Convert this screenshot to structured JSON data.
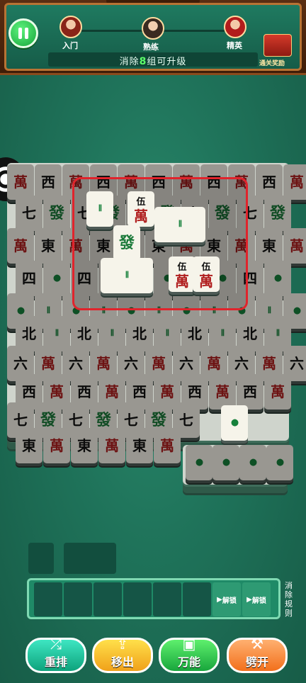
{
  "header": {
    "levels": [
      "入门",
      "熟练",
      "精英"
    ],
    "goal_prefix": "消除",
    "goal_count": "8",
    "goal_suffix": "组可升级",
    "reward_label": "通关奖励"
  },
  "tiles": {
    "wan_small": "伍",
    "wan_big": "萬",
    "six": "六",
    "bamboo": "𝍪",
    "green": "發",
    "dong": "東",
    "north": "北",
    "west": "西",
    "seven": "七",
    "four": "四",
    "bean": "●"
  },
  "tray": {
    "unlock_label": "解锁",
    "rules_label": "消除规则"
  },
  "tools": [
    {
      "label": "重排",
      "icon": "shuffle-icon"
    },
    {
      "label": "移出",
      "icon": "move-out-icon"
    },
    {
      "label": "万能",
      "icon": "wildcard-icon"
    },
    {
      "label": "劈开",
      "icon": "axe-icon"
    }
  ],
  "colors": {
    "felt": "#1f735a",
    "highlight": "#e0242c",
    "wan_red": "#b01e1e"
  }
}
